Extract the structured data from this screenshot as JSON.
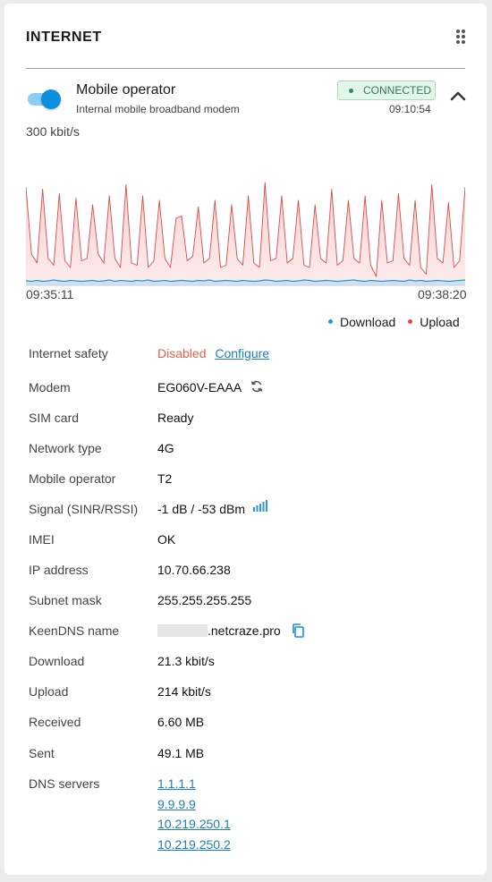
{
  "card": {
    "title": "INTERNET"
  },
  "interface": {
    "name": "Mobile operator",
    "description": "Internal mobile broadband modem",
    "enabled": true,
    "status": "CONNECTED",
    "uptime": "09:10:54",
    "accent_color": "#0d8ee0",
    "status_color": "#2e7d57"
  },
  "chart_data": {
    "type": "area",
    "scale_label": "300 kbit/s",
    "ylim": [
      0,
      300
    ],
    "x_start_label": "09:35:11",
    "x_end_label": "09:38:20",
    "grid": false,
    "legend_position": "bottom-right",
    "series": [
      {
        "name": "Download",
        "color": "#1a9be0",
        "values": [
          10,
          9,
          11,
          9,
          10,
          12,
          10,
          9,
          11,
          10,
          9,
          10,
          11,
          9,
          10,
          12,
          9,
          11,
          10,
          9,
          11,
          10,
          12,
          9,
          10,
          11,
          9,
          10,
          11,
          10,
          9,
          11,
          10,
          12,
          9,
          10,
          11,
          10,
          9,
          11,
          10,
          9,
          10,
          12,
          11,
          9,
          10,
          11,
          9,
          10,
          12,
          11,
          9,
          10,
          11,
          10,
          9,
          10,
          11,
          12,
          10,
          9,
          11,
          10,
          9,
          10,
          11,
          10,
          9,
          12,
          10,
          11,
          9,
          10,
          11,
          10,
          9,
          10,
          11,
          12
        ]
      },
      {
        "name": "Upload",
        "color": "#e04848",
        "values": [
          220,
          70,
          50,
          215,
          60,
          45,
          205,
          55,
          40,
          195,
          55,
          60,
          180,
          70,
          50,
          200,
          60,
          40,
          225,
          50,
          45,
          200,
          40,
          55,
          190,
          60,
          40,
          150,
          155,
          55,
          65,
          175,
          50,
          60,
          190,
          40,
          45,
          180,
          60,
          45,
          200,
          50,
          40,
          230,
          55,
          60,
          200,
          50,
          60,
          190,
          45,
          40,
          180,
          60,
          50,
          215,
          45,
          55,
          190,
          60,
          50,
          200,
          45,
          20,
          190,
          50,
          55,
          205,
          60,
          45,
          190,
          40,
          25,
          225,
          60,
          50,
          185,
          40,
          55,
          220
        ]
      }
    ]
  },
  "legend": {
    "download": "Download",
    "upload": "Upload"
  },
  "info": {
    "internet_safety": {
      "label": "Internet safety",
      "value": "Disabled",
      "action": "Configure"
    },
    "modem": {
      "label": "Modem",
      "value": "EG060V-EAAA"
    },
    "sim_card": {
      "label": "SIM card",
      "value": "Ready"
    },
    "network_type": {
      "label": "Network type",
      "value": "4G"
    },
    "mobile_operator": {
      "label": "Mobile operator",
      "value": "T2"
    },
    "signal": {
      "label": "Signal (SINR/RSSI)",
      "value": "-1 dB / -53 dBm"
    },
    "imei": {
      "label": "IMEI",
      "value": "OK"
    },
    "ip_address": {
      "label": "IP address",
      "value": "10.70.66.238"
    },
    "subnet_mask": {
      "label": "Subnet mask",
      "value": "255.255.255.255"
    },
    "keendns": {
      "label": "KeenDNS name",
      "value": ".netcraze.pro"
    },
    "download": {
      "label": "Download",
      "value": "21.3 kbit/s"
    },
    "upload": {
      "label": "Upload",
      "value": "214 kbit/s"
    },
    "received": {
      "label": "Received",
      "value": "6.60 MB"
    },
    "sent": {
      "label": "Sent",
      "value": "49.1 MB"
    },
    "dns": {
      "label": "DNS servers",
      "servers": [
        "1.1.1.1",
        "9.9.9.9",
        "10.219.250.1",
        "10.219.250.2"
      ]
    }
  }
}
